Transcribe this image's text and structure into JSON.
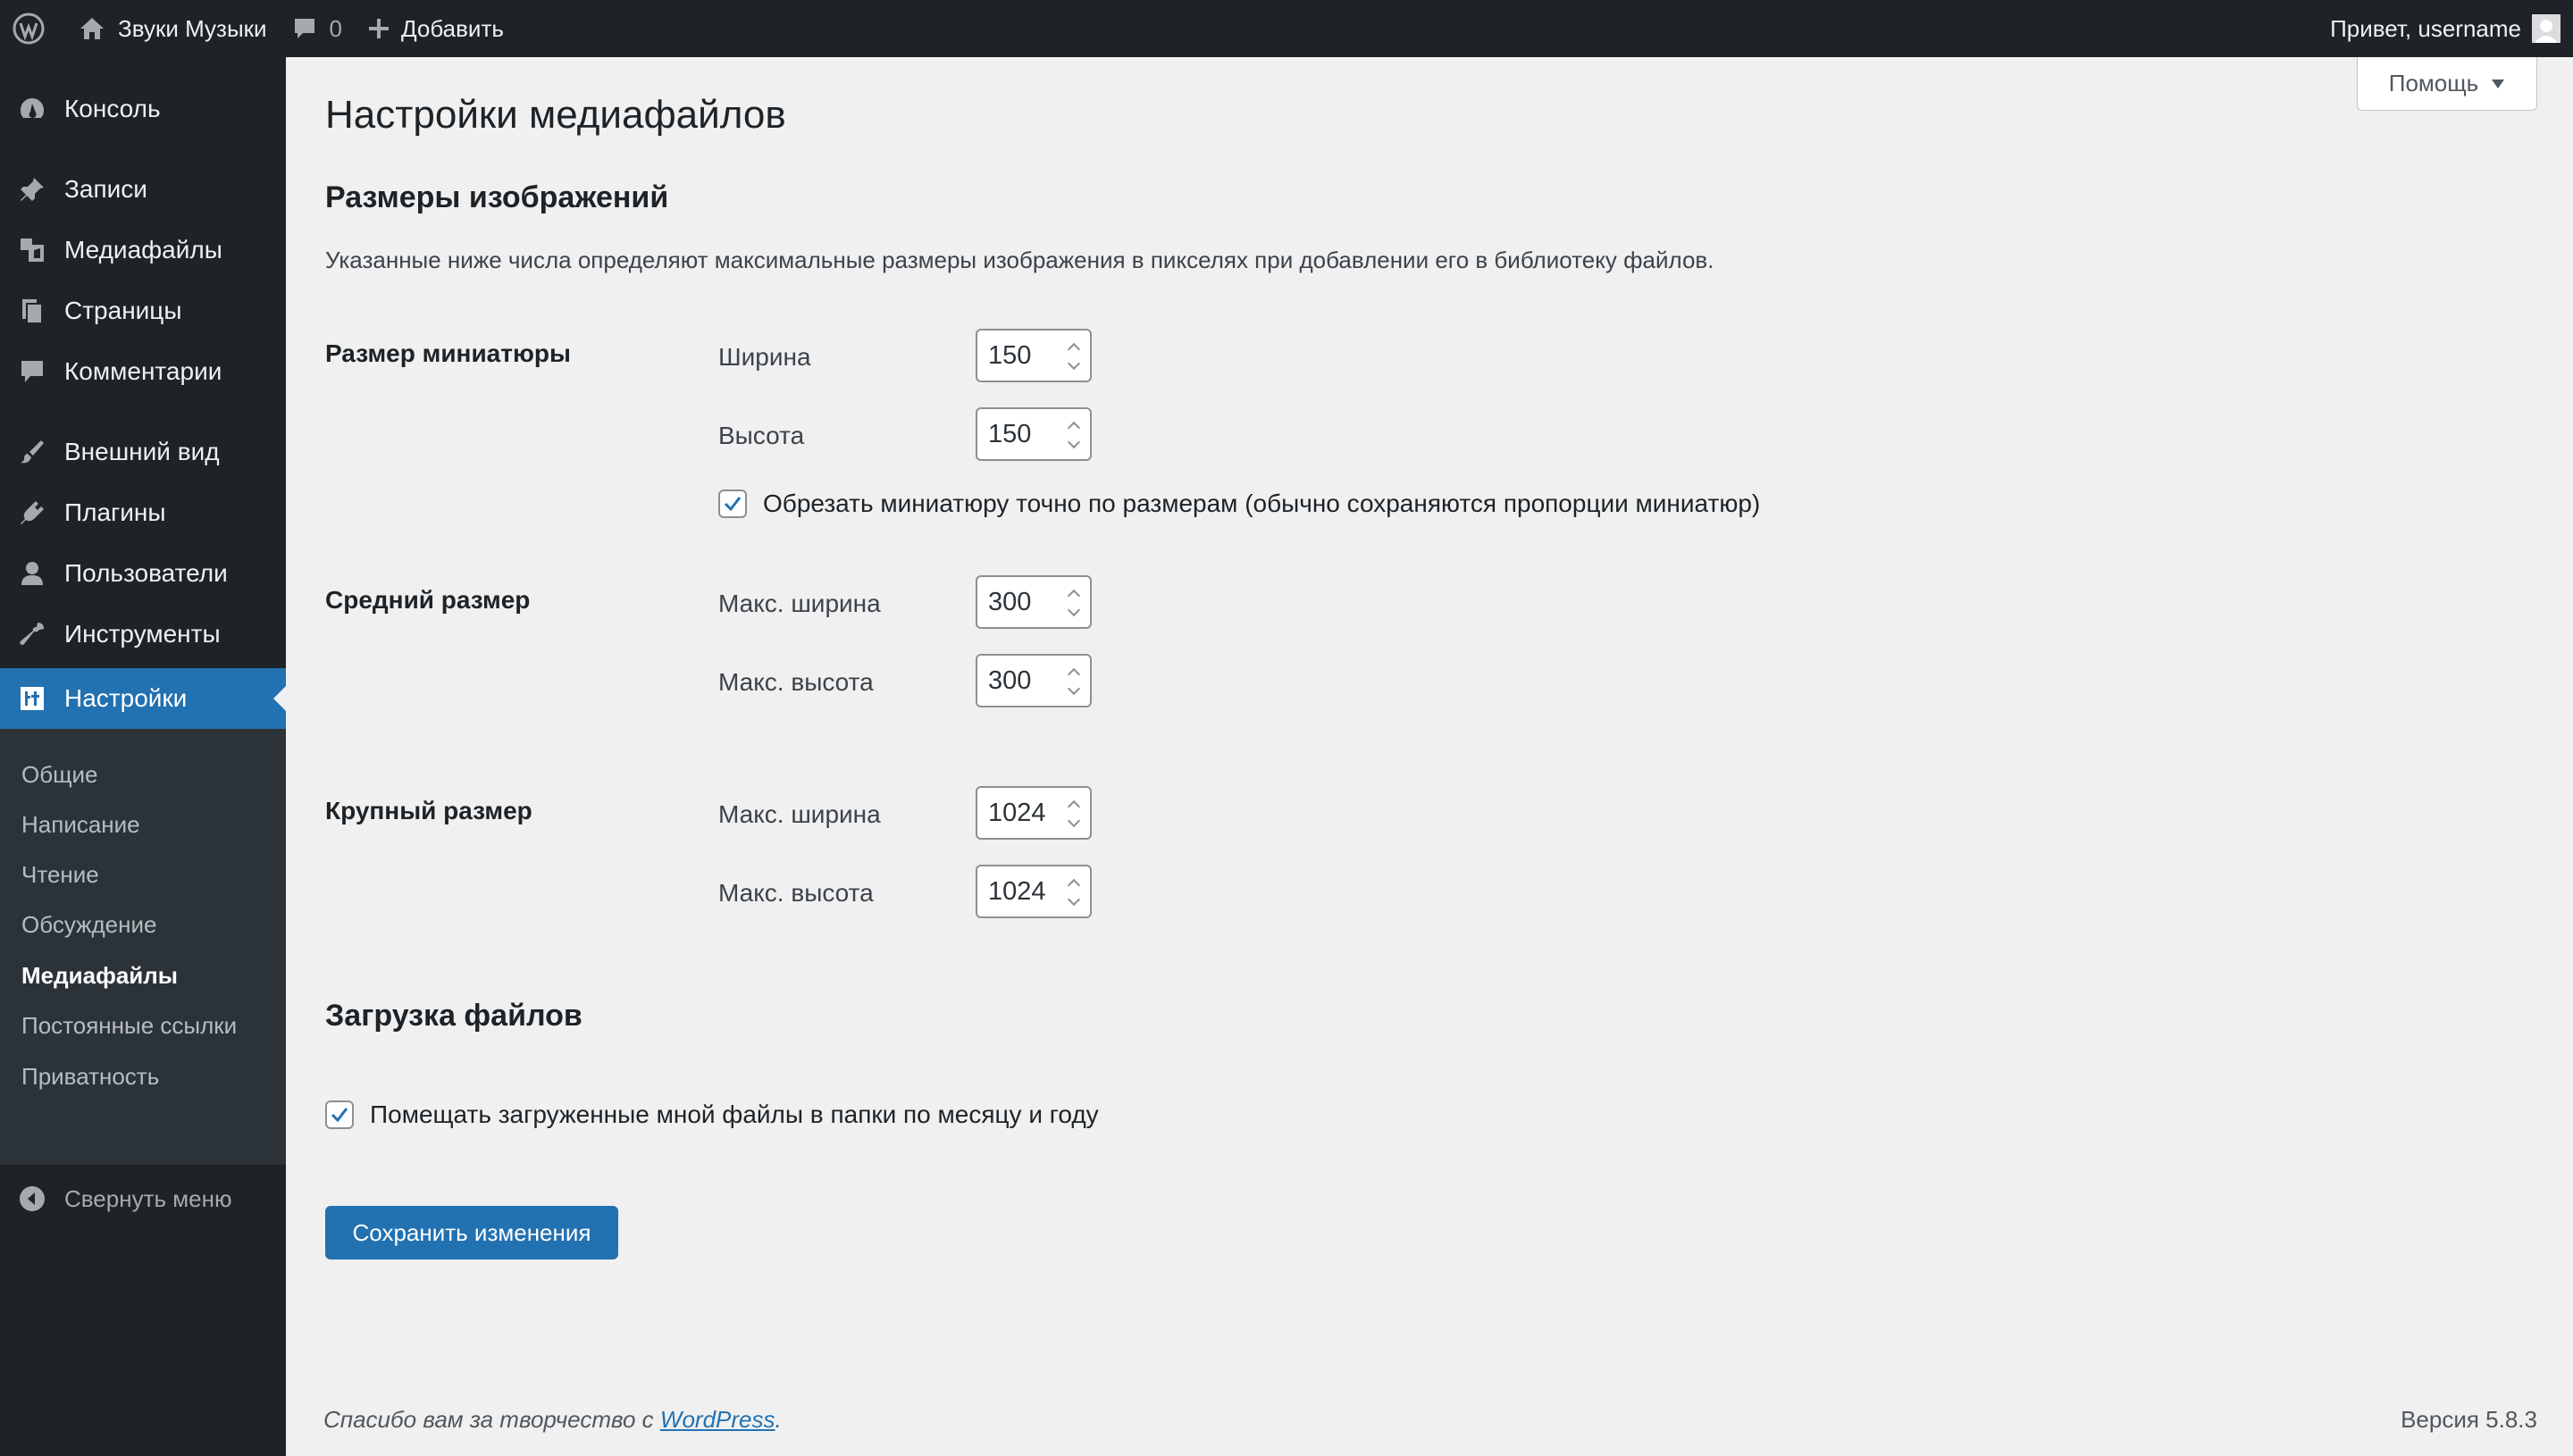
{
  "adminbar": {
    "site_name": "Звуки Музыки",
    "comments_count": "0",
    "new_label": "Добавить",
    "greeting": "Привет, username"
  },
  "sidebar": {
    "items": [
      {
        "label": "Консоль",
        "icon": "dashboard-icon"
      },
      {
        "label": "Записи",
        "icon": "pin-icon"
      },
      {
        "label": "Медиафайлы",
        "icon": "media-icon"
      },
      {
        "label": "Страницы",
        "icon": "pages-icon"
      },
      {
        "label": "Комментарии",
        "icon": "comments-icon"
      },
      {
        "label": "Внешний вид",
        "icon": "brush-icon"
      },
      {
        "label": "Плагины",
        "icon": "plugin-icon"
      },
      {
        "label": "Пользователи",
        "icon": "users-icon"
      },
      {
        "label": "Инструменты",
        "icon": "wrench-icon"
      },
      {
        "label": "Настройки",
        "icon": "settings-icon",
        "current": true
      }
    ],
    "submenu": [
      "Общие",
      "Написание",
      "Чтение",
      "Обсуждение",
      "Медиафайлы",
      "Постоянные ссылки",
      "Приватность"
    ],
    "submenu_current": "Медиафайлы",
    "collapse_label": "Свернуть меню"
  },
  "help": {
    "label": "Помощь"
  },
  "page": {
    "title": "Настройки медиафайлов",
    "image_sizes_heading": "Размеры изображений",
    "description": "Указанные ниже числа определяют максимальные размеры изображения в пикселях при добавлении его в библиотеку файлов.",
    "thumbnail": {
      "label": "Размер миниатюры",
      "width_label": "Ширина",
      "width": "150",
      "height_label": "Высота",
      "height": "150",
      "crop_label": "Обрезать миниатюру точно по размерам (обычно сохраняются пропорции миниатюр)",
      "crop_checked": true
    },
    "medium": {
      "label": "Средний размер",
      "width_label": "Макс. ширина",
      "width": "300",
      "height_label": "Макс. высота",
      "height": "300"
    },
    "large": {
      "label": "Крупный размер",
      "width_label": "Макс. ширина",
      "width": "1024",
      "height_label": "Макс. высота",
      "height": "1024"
    },
    "uploads_heading": "Загрузка файлов",
    "uploads_label": "Помещать загруженные мной файлы в папки по месяцу и году",
    "uploads_checked": true,
    "save_label": "Сохранить изменения"
  },
  "footer": {
    "thanks_prefix": "Спасибо вам за творчество с ",
    "thanks_link": "WordPress",
    "thanks_suffix": ".",
    "version": "Версия 5.8.3"
  },
  "colors": {
    "accent": "#2271b1",
    "sidebar_bg": "#1d2327",
    "submenu_bg": "#2c3338",
    "content_bg": "#f0f0f1"
  }
}
